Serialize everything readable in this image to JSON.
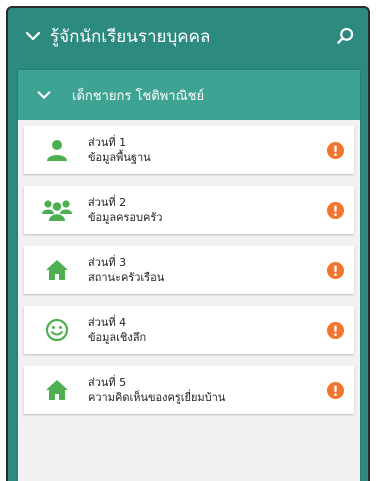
{
  "appbar": {
    "title": "รู้จักนักเรียนรายบุคคล",
    "chevron_icon": "chevron-down-icon",
    "search_icon": "search-icon"
  },
  "panel": {
    "student_name": "เด็กชายกร โชติพาณิชย์",
    "chevron_icon": "chevron-down-icon"
  },
  "sections": [
    {
      "label": "ส่วนที่ 1",
      "desc": "ข้อมูลพื้นฐาน",
      "icon": "person-icon"
    },
    {
      "label": "ส่วนที่ 2",
      "desc": "ข้อมูลครอบครัว",
      "icon": "family-icon"
    },
    {
      "label": "ส่วนที่ 3",
      "desc": "สถานะครัวเรือน",
      "icon": "home-icon"
    },
    {
      "label": "ส่วนที่ 4",
      "desc": "ข้อมูลเชิงลึก",
      "icon": "smiley-icon"
    },
    {
      "label": "ส่วนที่ 5",
      "desc": "ความคิดเห็นของครูเยี่ยมบ้าน",
      "icon": "home-icon"
    }
  ],
  "colors": {
    "primary": "#2c8a7f",
    "header": "#3fa394",
    "icon_green": "#4caf50",
    "alert_orange": "#f4742b"
  }
}
